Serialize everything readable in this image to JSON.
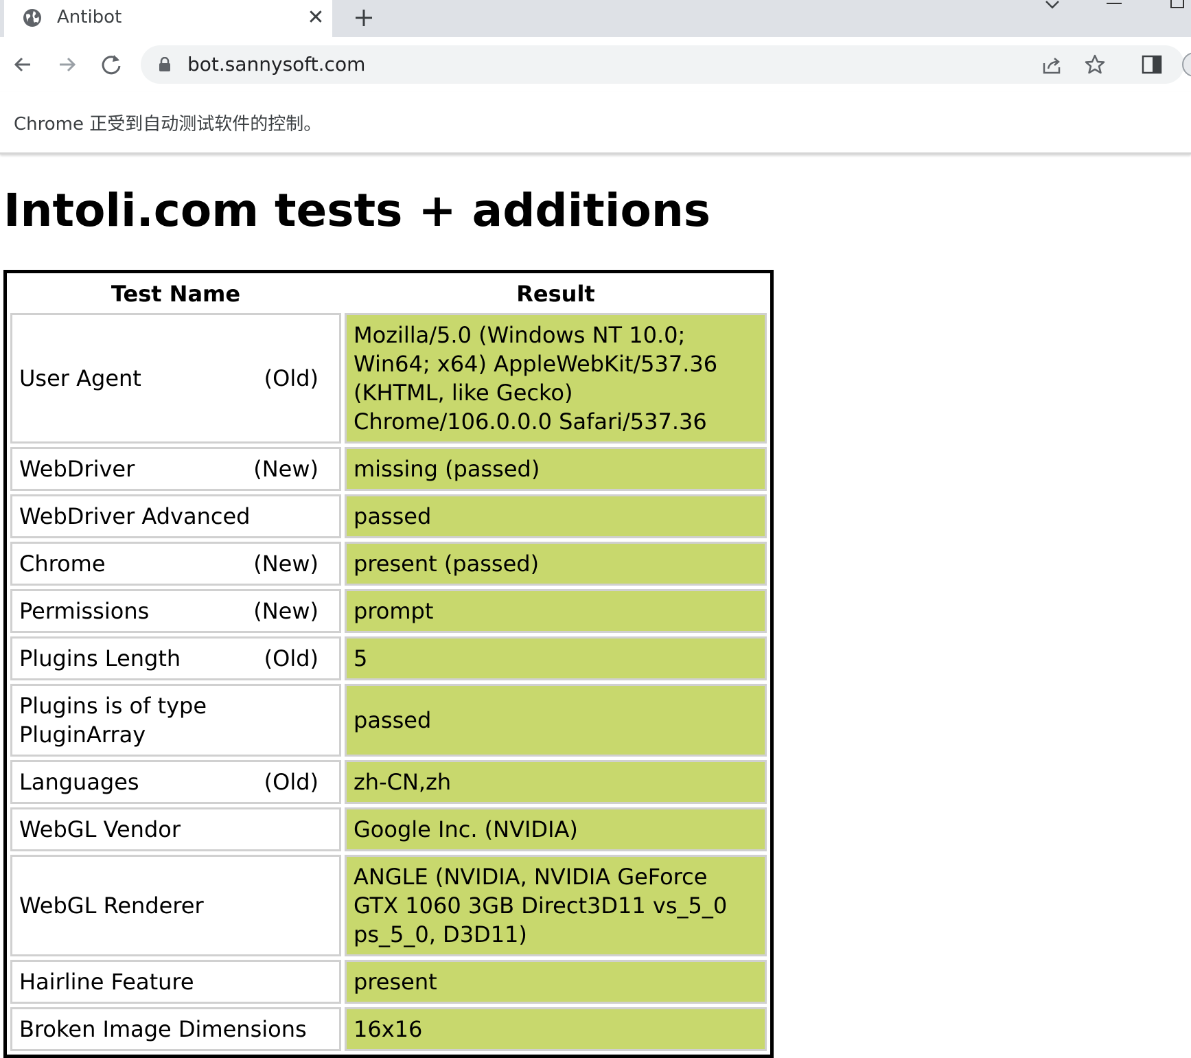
{
  "browser": {
    "tab": {
      "title": "Antibot",
      "close_label": "✕",
      "new_tab_label": "+"
    },
    "url": "bot.sannysoft.com",
    "infobar_text": "Chrome 正受到自动测试软件的控制。"
  },
  "page": {
    "title": "Intoli.com tests + additions",
    "table": {
      "headers": [
        "Test Name",
        "Result"
      ],
      "rows": [
        {
          "name": "User Agent",
          "tag": "(Old)",
          "result": "Mozilla/5.0 (Windows NT 10.0; Win64; x64) AppleWebKit/537.36 (KHTML, like Gecko) Chrome/106.0.0.0 Safari/537.36"
        },
        {
          "name": "WebDriver",
          "tag": "(New)",
          "result": "missing (passed)"
        },
        {
          "name": "WebDriver Advanced",
          "tag": "",
          "result": "passed"
        },
        {
          "name": "Chrome",
          "tag": "(New)",
          "result": "present (passed)"
        },
        {
          "name": "Permissions",
          "tag": "(New)",
          "result": "prompt"
        },
        {
          "name": "Plugins Length",
          "tag": "(Old)",
          "result": "5"
        },
        {
          "name": "Plugins is of type PluginArray",
          "tag": "",
          "result": "passed"
        },
        {
          "name": "Languages",
          "tag": "(Old)",
          "result": "zh-CN,zh"
        },
        {
          "name": "WebGL Vendor",
          "tag": "",
          "result": "Google Inc. (NVIDIA)"
        },
        {
          "name": "WebGL Renderer",
          "tag": "",
          "result": "ANGLE (NVIDIA, NVIDIA GeForce GTX 1060 3GB Direct3D11 vs_5_0 ps_5_0, D3D11)"
        },
        {
          "name": "Hairline Feature",
          "tag": "",
          "result": "present"
        },
        {
          "name": "Broken Image Dimensions",
          "tag": "",
          "result": "16x16"
        }
      ]
    }
  },
  "colors": {
    "passed_bg": "#c8d86d",
    "tabstrip_bg": "#dee1e6",
    "omnibox_bg": "#f1f3f4"
  },
  "icons": [
    "globe-icon",
    "close-icon",
    "plus-icon",
    "chevron-down-icon",
    "minimize-icon",
    "maximize-icon",
    "back-arrow-icon",
    "forward-arrow-icon",
    "reload-icon",
    "lock-icon",
    "share-icon",
    "star-icon",
    "side-panel-icon",
    "profile-avatar"
  ]
}
